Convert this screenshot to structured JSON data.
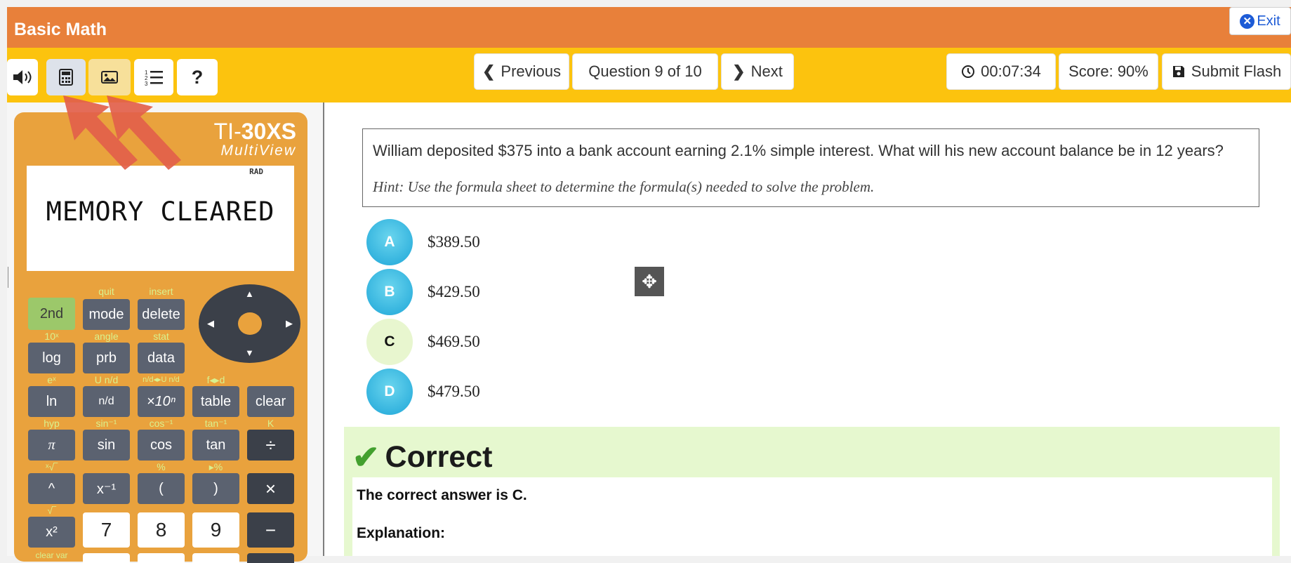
{
  "app": {
    "title": "Basic Math",
    "exit_label": "Exit"
  },
  "toolbar": {
    "audio_icon": "volume-icon",
    "calculator_icon": "calculator-icon",
    "image_icon": "image-icon",
    "list_icon": "list-icon",
    "help_label": "?",
    "previous_label": "Previous",
    "question_counter": "Question 9 of 10",
    "next_label": "Next",
    "timer": "00:07:34",
    "score": "Score: 90%",
    "submit_label": "Submit Flash"
  },
  "calculator": {
    "brand_prefix": "TI-",
    "brand_model": "30XS",
    "brand_sub": "MultiView",
    "mode_indicator": "RAD",
    "display": "MEMORY CLEARED",
    "keys": {
      "second": {
        "face": "2nd",
        "top": ""
      },
      "mode": {
        "face": "mode",
        "top": "quit"
      },
      "delete": {
        "face": "delete",
        "top": "insert"
      },
      "log": {
        "face": "log",
        "top": "10ˣ"
      },
      "prb": {
        "face": "prb",
        "top": "angle"
      },
      "data": {
        "face": "data",
        "top": "stat"
      },
      "ln": {
        "face": "ln",
        "top": "eˣ"
      },
      "frac": {
        "face": "n/d",
        "top": "U n/d"
      },
      "x10n": {
        "face": "×10ⁿ",
        "top": "n/d◂▸U n/d"
      },
      "table": {
        "face": "table",
        "top": "f◂▸d"
      },
      "clear": {
        "face": "clear",
        "top": ""
      },
      "pi": {
        "face": "π",
        "top": "hyp"
      },
      "sin": {
        "face": "sin",
        "top": "sin⁻¹"
      },
      "cos": {
        "face": "cos",
        "top": "cos⁻¹"
      },
      "tan": {
        "face": "tan",
        "top": "tan⁻¹"
      },
      "divide": {
        "face": "÷",
        "top": "K"
      },
      "caret": {
        "face": "^",
        "top": "ˣ√‾"
      },
      "inverse": {
        "face": "x⁻¹",
        "top": ""
      },
      "lparen": {
        "face": "(",
        "top": "%"
      },
      "rparen": {
        "face": ")",
        "top": "▸%"
      },
      "multiply": {
        "face": "×",
        "top": ""
      },
      "square": {
        "face": "x²",
        "top": "√‾"
      },
      "seven": {
        "face": "7",
        "top": ""
      },
      "eight": {
        "face": "8",
        "top": ""
      },
      "nine": {
        "face": "9",
        "top": ""
      },
      "minus": {
        "face": "−",
        "top": ""
      },
      "clearvar": {
        "face": "",
        "top": "clear var"
      }
    }
  },
  "question": {
    "text": "William deposited $375 into a bank account earning 2.1% simple interest. What will his new account balance be in 12 years?",
    "hint": "Hint: Use the formula sheet to determine the formula(s) needed to solve the problem.",
    "choices": [
      {
        "letter": "A",
        "value": "$389.50"
      },
      {
        "letter": "B",
        "value": "$429.50"
      },
      {
        "letter": "C",
        "value": "$469.50"
      },
      {
        "letter": "D",
        "value": "$479.50"
      }
    ]
  },
  "result": {
    "heading": "Correct",
    "answer_text": "The correct answer is C.",
    "explanation_label": "Explanation:"
  },
  "colors": {
    "title_bar": "#e8803a",
    "toolbar": "#fcc30e",
    "correct_bg": "#e6f8cf",
    "choice": "#1ea6d8"
  }
}
